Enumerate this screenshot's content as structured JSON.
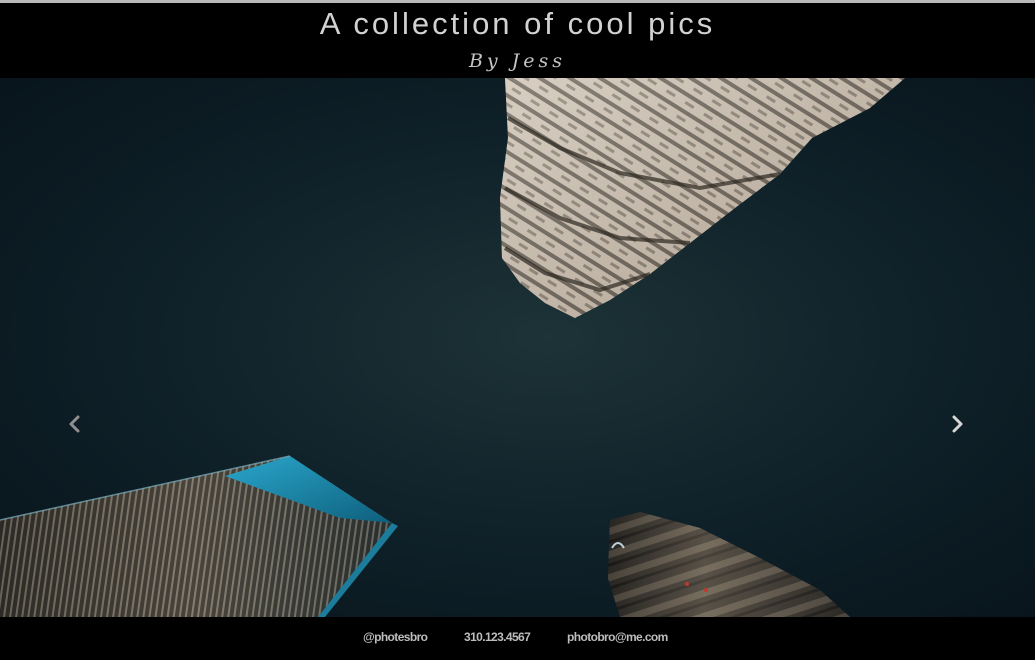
{
  "header": {
    "title": "A collection of cool pics",
    "byline": "By Jess"
  },
  "slideshow": {
    "prev_icon": "chevron-left-icon",
    "next_icon": "chevron-right-icon",
    "image_description_icon": "photo-skyscrapers-night"
  },
  "footer": {
    "handle": "@photesbro",
    "phone": "310.123.4567",
    "email": "photobro@me.com"
  },
  "colors": {
    "background": "#000000",
    "title_text": "#d2d2d2",
    "footer_text": "#bdbdbd",
    "sky": "#0f2024",
    "accent_glass": "#1a8fb5"
  }
}
